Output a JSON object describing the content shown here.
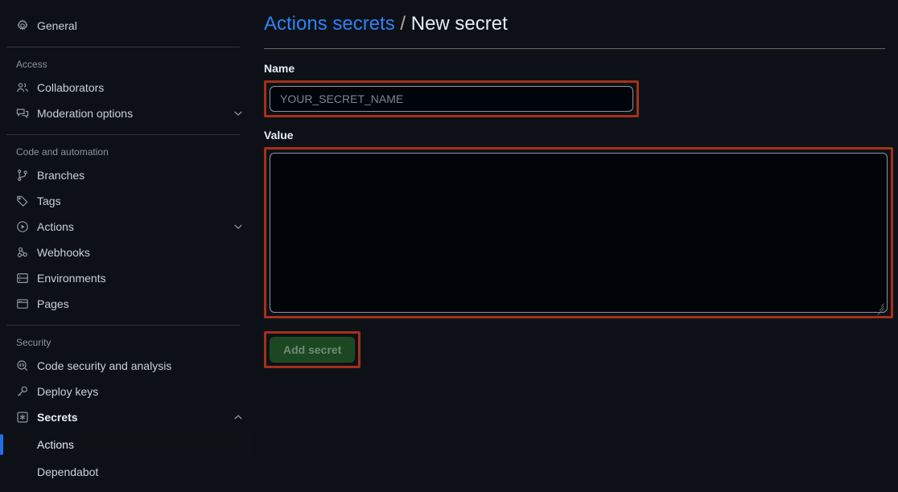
{
  "theme": {
    "background": "#0d1117",
    "accent_link": "#2f81f7",
    "annotation_red": "#a33117",
    "selected_bar": "#1f6feb",
    "button_green_bg": "#1b4721",
    "button_green_text": "#6f8b76",
    "border": "#30363d",
    "text_primary": "#e6edf3",
    "text_muted": "#8b949e"
  },
  "sidebar": {
    "top_items": [
      {
        "label": "General",
        "icon": "gear-icon",
        "chevron": false
      }
    ],
    "sections": [
      {
        "title": "Access",
        "items": [
          {
            "label": "Collaborators",
            "icon": "people-icon",
            "chevron": false
          },
          {
            "label": "Moderation options",
            "icon": "comment-discussion-icon",
            "chevron": true
          }
        ]
      },
      {
        "title": "Code and automation",
        "items": [
          {
            "label": "Branches",
            "icon": "git-branch-icon",
            "chevron": false
          },
          {
            "label": "Tags",
            "icon": "tag-icon",
            "chevron": false
          },
          {
            "label": "Actions",
            "icon": "play-circle-icon",
            "chevron": true
          },
          {
            "label": "Webhooks",
            "icon": "webhook-icon",
            "chevron": false
          },
          {
            "label": "Environments",
            "icon": "server-icon",
            "chevron": false
          },
          {
            "label": "Pages",
            "icon": "browser-icon",
            "chevron": false
          }
        ]
      },
      {
        "title": "Security",
        "items": [
          {
            "label": "Code security and analysis",
            "icon": "codescan-icon",
            "chevron": false
          },
          {
            "label": "Deploy keys",
            "icon": "key-icon",
            "chevron": false
          },
          {
            "label": "Secrets",
            "icon": "asterisk-square-icon",
            "chevron": true,
            "expanded": true,
            "bold": true
          }
        ],
        "sub_items": [
          {
            "label": "Actions",
            "selected": true
          },
          {
            "label": "Dependabot",
            "selected": false
          }
        ]
      }
    ]
  },
  "main": {
    "breadcrumb": {
      "parent": "Actions secrets",
      "separator": "/",
      "current": "New secret"
    },
    "name_field": {
      "label": "Name",
      "placeholder": "YOUR_SECRET_NAME",
      "value": ""
    },
    "value_field": {
      "label": "Value",
      "placeholder": "",
      "value": ""
    },
    "submit": {
      "label": "Add secret",
      "disabled": true
    }
  }
}
